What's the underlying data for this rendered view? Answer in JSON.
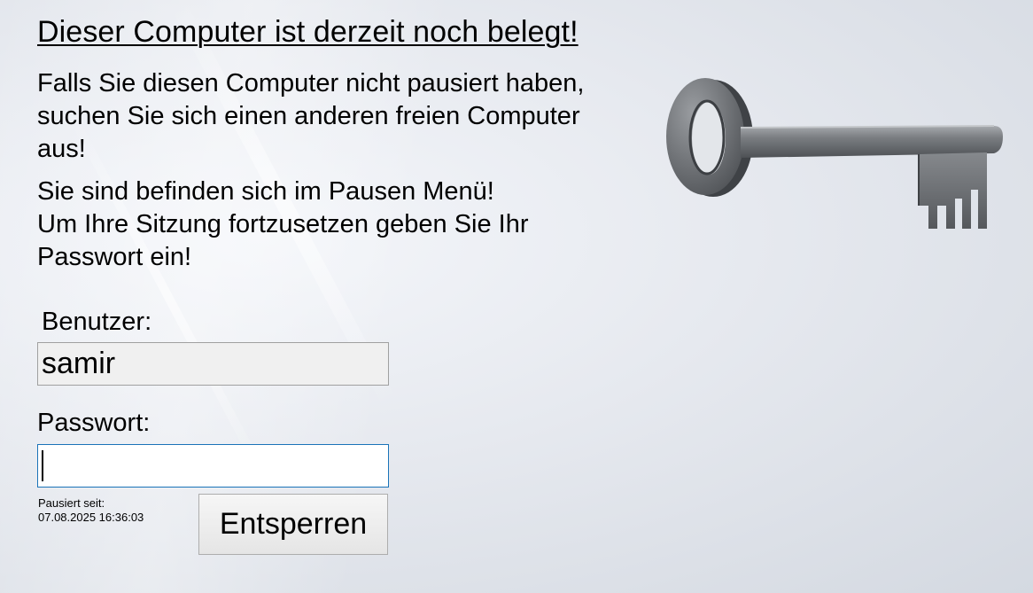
{
  "title": "Dieser Computer ist derzeit noch belegt!",
  "message_occupied": "Falls Sie diesen Computer nicht pausiert haben, suchen Sie sich einen anderen freien Computer aus!",
  "message_paused": "Sie sind befinden sich im Pausen Menü!\nUm Ihre Sitzung fortzusetzen geben Sie Ihr Passwort ein!",
  "user": {
    "label": "Benutzer:",
    "value": "samir"
  },
  "password": {
    "label": "Passwort:",
    "value": ""
  },
  "paused_since": {
    "label": "Pausiert seit:",
    "timestamp": "07.08.2025 16:36:03"
  },
  "unlock_button_label": "Entsperren",
  "icon": "key-icon",
  "colors": {
    "focus_border": "#1a73b8",
    "readonly_field_bg": "#f0f0f0",
    "key_metal": "#6a6d71"
  }
}
